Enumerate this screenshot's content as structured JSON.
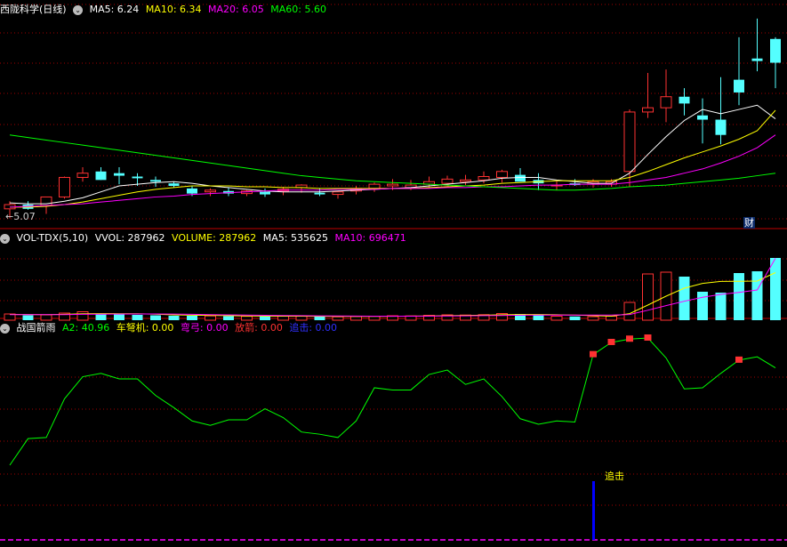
{
  "price_panel": {
    "title": "西陇科学(日线)",
    "ma5": "MA5: 6.24",
    "ma10": "MA10: 6.34",
    "ma20": "MA20: 6.05",
    "ma60": "MA60: 5.60",
    "low_marker": "5.07",
    "fin_badge": "财"
  },
  "volume_panel": {
    "indicator": "VOL-TDX(5,10)",
    "vvol": "VVOL: 287962",
    "volume": "VOLUME: 287962",
    "ma5": "MA5: 535625",
    "ma10": "MA10: 696471"
  },
  "signal_panel": {
    "name": "战国箭雨",
    "a2": "A2: 40.96",
    "chenuji": "车弩机: 0.00",
    "wangong": "弯弓: 0.00",
    "fangjian": "放箭: 0.00",
    "zhuiji": "追击: 0.00",
    "zhuiji_label": "追击"
  },
  "colors": {
    "up": "#ff3232",
    "down": "#54ffff",
    "ma5": "#ffffff",
    "ma10": "#ffff00",
    "ma20": "#ff00ff",
    "ma60": "#00ff00",
    "grid": "#a00000",
    "signal": "#0000ff",
    "baseline": "#ff00ff"
  },
  "chart_data": [
    {
      "type": "candlestick",
      "title": "西陇科学(日线)",
      "x": [
        1,
        2,
        3,
        4,
        5,
        6,
        7,
        8,
        9,
        10,
        11,
        12,
        13,
        14,
        15,
        16,
        17,
        18,
        19,
        20,
        21,
        22,
        23,
        24,
        25,
        26,
        27,
        28,
        29,
        30,
        31,
        32,
        33,
        34,
        35,
        36,
        37,
        38,
        39,
        40,
        41,
        42,
        43
      ],
      "open": [
        5.18,
        5.23,
        5.22,
        5.32,
        5.55,
        5.62,
        5.6,
        5.56,
        5.52,
        5.48,
        5.42,
        5.38,
        5.39,
        5.36,
        5.38,
        5.39,
        5.43,
        5.37,
        5.35,
        5.39,
        5.42,
        5.45,
        5.43,
        5.47,
        5.48,
        5.5,
        5.52,
        5.55,
        5.58,
        5.52,
        5.45,
        5.48,
        5.47,
        5.47,
        5.62,
        6.32,
        6.37,
        6.5,
        6.28,
        6.23,
        6.7,
        6.95,
        7.18
      ],
      "high": [
        5.27,
        5.27,
        5.26,
        5.56,
        5.67,
        5.67,
        5.67,
        5.6,
        5.56,
        5.5,
        5.45,
        5.42,
        5.43,
        5.4,
        5.42,
        5.44,
        5.47,
        5.42,
        5.39,
        5.45,
        5.49,
        5.53,
        5.52,
        5.56,
        5.57,
        5.58,
        5.62,
        5.64,
        5.66,
        5.6,
        5.51,
        5.53,
        5.53,
        5.53,
        6.35,
        6.78,
        6.82,
        6.6,
        6.48,
        6.73,
        7.2,
        7.42,
        7.2
      ],
      "low": [
        5.07,
        5.17,
        5.12,
        5.3,
        5.5,
        5.52,
        5.47,
        5.45,
        5.44,
        5.43,
        5.33,
        5.33,
        5.33,
        5.33,
        5.32,
        5.34,
        5.37,
        5.33,
        5.3,
        5.35,
        5.38,
        5.4,
        5.4,
        5.43,
        5.44,
        5.46,
        5.48,
        5.49,
        5.52,
        5.4,
        5.4,
        5.45,
        5.43,
        5.44,
        5.44,
        6.25,
        6.2,
        6.28,
        5.95,
        5.94,
        6.4,
        6.8,
        6.6
      ],
      "close": [
        5.23,
        5.18,
        5.32,
        5.55,
        5.6,
        5.52,
        5.57,
        5.54,
        5.5,
        5.45,
        5.36,
        5.4,
        5.36,
        5.39,
        5.35,
        5.41,
        5.46,
        5.35,
        5.38,
        5.42,
        5.47,
        5.47,
        5.46,
        5.5,
        5.53,
        5.52,
        5.56,
        5.62,
        5.5,
        5.48,
        5.46,
        5.46,
        5.5,
        5.5,
        6.32,
        6.37,
        6.5,
        6.42,
        6.23,
        6.05,
        6.55,
        6.92,
        6.9
      ],
      "series": [
        {
          "name": "MA5",
          "values": [
            5.25,
            5.24,
            5.24,
            5.27,
            5.31,
            5.38,
            5.45,
            5.47,
            5.49,
            5.5,
            5.48,
            5.45,
            5.43,
            5.41,
            5.39,
            5.38,
            5.38,
            5.38,
            5.39,
            5.4,
            5.41,
            5.42,
            5.43,
            5.45,
            5.47,
            5.49,
            5.51,
            5.54,
            5.55,
            5.55,
            5.52,
            5.5,
            5.48,
            5.48,
            5.6,
            5.82,
            6.03,
            6.22,
            6.35,
            6.3,
            6.35,
            6.4,
            6.24
          ]
        },
        {
          "name": "MA10",
          "values": [
            5.2,
            5.2,
            5.21,
            5.23,
            5.26,
            5.3,
            5.34,
            5.38,
            5.41,
            5.43,
            5.45,
            5.45,
            5.45,
            5.44,
            5.44,
            5.43,
            5.43,
            5.42,
            5.42,
            5.42,
            5.42,
            5.42,
            5.42,
            5.43,
            5.44,
            5.45,
            5.46,
            5.48,
            5.49,
            5.5,
            5.51,
            5.51,
            5.51,
            5.51,
            5.55,
            5.62,
            5.7,
            5.78,
            5.85,
            5.92,
            6.0,
            6.1,
            6.34
          ]
        },
        {
          "name": "MA20",
          "values": [
            5.2,
            5.21,
            5.22,
            5.23,
            5.24,
            5.26,
            5.28,
            5.3,
            5.32,
            5.33,
            5.35,
            5.36,
            5.37,
            5.38,
            5.39,
            5.4,
            5.4,
            5.4,
            5.41,
            5.41,
            5.41,
            5.42,
            5.42,
            5.42,
            5.43,
            5.43,
            5.44,
            5.44,
            5.45,
            5.46,
            5.46,
            5.47,
            5.47,
            5.47,
            5.49,
            5.52,
            5.55,
            5.6,
            5.65,
            5.72,
            5.8,
            5.9,
            6.05
          ]
        },
        {
          "name": "MA60",
          "values": [
            6.05,
            6.02,
            5.99,
            5.96,
            5.93,
            5.9,
            5.87,
            5.84,
            5.81,
            5.78,
            5.75,
            5.72,
            5.69,
            5.66,
            5.63,
            5.6,
            5.57,
            5.55,
            5.53,
            5.51,
            5.5,
            5.49,
            5.48,
            5.47,
            5.46,
            5.45,
            5.44,
            5.43,
            5.42,
            5.41,
            5.4,
            5.4,
            5.41,
            5.42,
            5.44,
            5.45,
            5.46,
            5.48,
            5.5,
            5.52,
            5.54,
            5.57,
            5.6
          ]
        }
      ],
      "ylim": [
        5.0,
        7.45
      ]
    },
    {
      "type": "bar",
      "title": "VOL-TDX(5,10)",
      "values": [
        70,
        55,
        60,
        80,
        95,
        70,
        65,
        60,
        55,
        50,
        50,
        48,
        45,
        44,
        43,
        45,
        47,
        40,
        38,
        42,
        45,
        50,
        48,
        55,
        60,
        58,
        62,
        75,
        70,
        55,
        45,
        42,
        40,
        45,
        200,
        520,
        540,
        490,
        320,
        310,
        530,
        550,
        700
      ],
      "series": [
        {
          "name": "MA5",
          "values": [
            65,
            64,
            62,
            66,
            72,
            74,
            73,
            72,
            68,
            60,
            56,
            54,
            51,
            48,
            46,
            45,
            45,
            44,
            43,
            42,
            42,
            44,
            46,
            48,
            51,
            54,
            56,
            61,
            64,
            64,
            61,
            57,
            51,
            45,
            74,
            170,
            270,
            360,
            414,
            436,
            438,
            440,
            535
          ]
        },
        {
          "name": "MA10",
          "values": [
            63,
            63,
            62,
            63,
            66,
            68,
            69,
            70,
            70,
            69,
            66,
            63,
            60,
            57,
            55,
            53,
            51,
            49,
            47,
            46,
            45,
            45,
            45,
            46,
            47,
            49,
            51,
            53,
            56,
            58,
            58,
            58,
            58,
            57,
            64,
            112,
            164,
            213,
            258,
            290,
            313,
            340,
            696
          ]
        }
      ],
      "ylim": [
        0,
        850
      ]
    },
    {
      "type": "line",
      "title": "战国箭雨",
      "series": [
        {
          "name": "A2",
          "values": [
            0,
            24,
            25,
            60,
            80,
            83,
            78,
            78,
            63,
            52,
            40,
            36,
            41,
            41,
            51,
            43,
            30,
            28,
            25,
            40,
            70,
            68,
            68,
            82,
            86,
            73,
            78,
            62,
            42,
            37,
            40,
            39,
            100,
            111,
            114,
            115,
            97,
            69,
            70,
            83,
            95,
            98,
            88
          ]
        }
      ],
      "markers": {
        "signal_indices": [
          32,
          33,
          34,
          35,
          40
        ],
        "zhuiji_index": 32
      },
      "ylim": [
        -5,
        130
      ]
    }
  ]
}
